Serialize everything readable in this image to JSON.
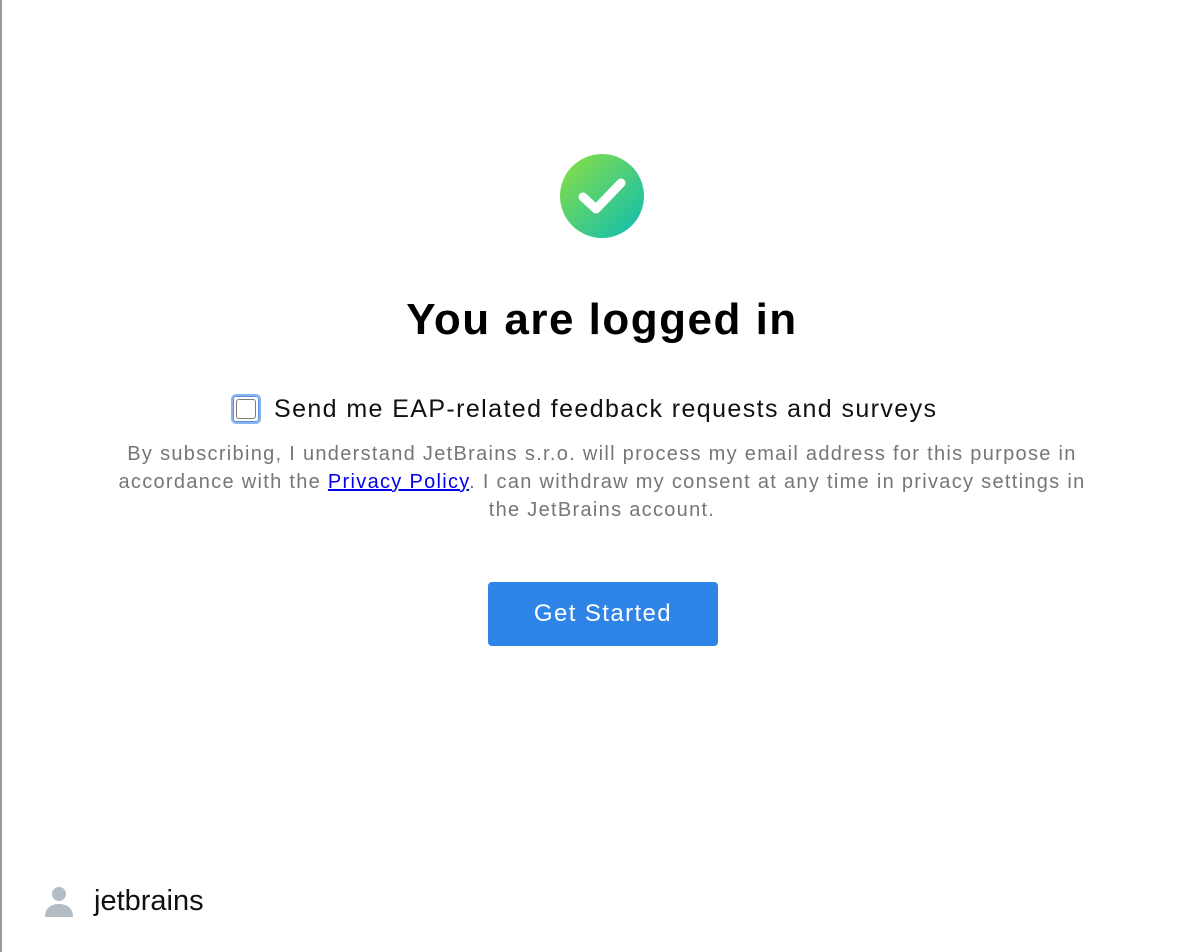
{
  "success": {
    "icon": "check-circle-icon",
    "gradient_start": "#8de03f",
    "gradient_end": "#0bbcb6"
  },
  "title": "You are logged in",
  "consent": {
    "checked": false,
    "label": "Send me EAP-related feedback requests and surveys"
  },
  "legal": {
    "before_link": "By subscribing, I understand JetBrains s.r.o. will process my email address for this purpose in accordance with the ",
    "link_text": "Privacy Policy",
    "after_link": ". I can withdraw my consent at any time in privacy settings in the JetBrains account."
  },
  "button": {
    "label": "Get Started",
    "color": "#2f84e8"
  },
  "user": {
    "icon": "user-icon",
    "name": "jetbrains"
  }
}
